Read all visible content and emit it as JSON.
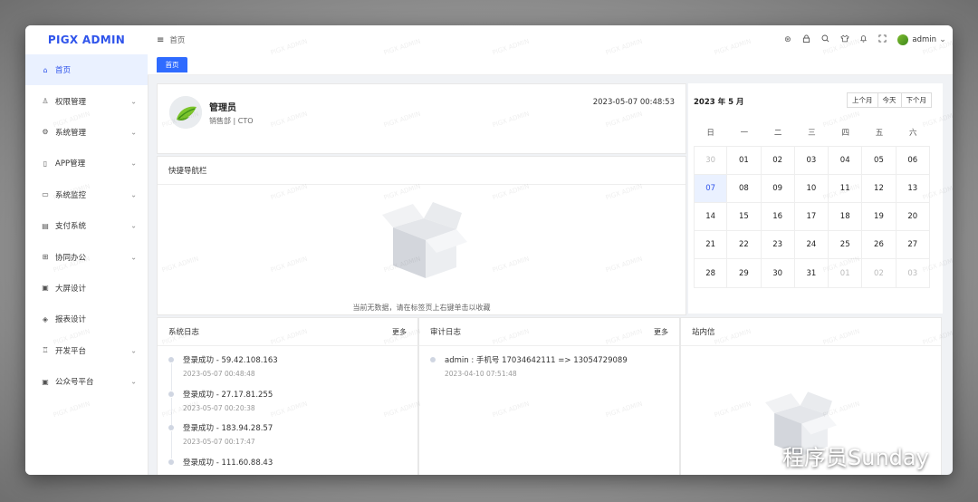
{
  "app": {
    "logo": "PIGX ADMIN",
    "watermark": "PIGX ADMIN"
  },
  "sidebar": {
    "items": [
      {
        "label": "首页",
        "icon": "home-icon",
        "glyph": "⌂",
        "active": true,
        "chevron": false
      },
      {
        "label": "权限管理",
        "icon": "user-icon",
        "glyph": "♙",
        "chevron": true
      },
      {
        "label": "系统管理",
        "icon": "gear-icon",
        "glyph": "⚙",
        "chevron": true
      },
      {
        "label": "APP管理",
        "icon": "phone-icon",
        "glyph": "▯",
        "chevron": true
      },
      {
        "label": "系统监控",
        "icon": "monitor-icon",
        "glyph": "▭",
        "chevron": true
      },
      {
        "label": "支付系统",
        "icon": "payment-icon",
        "glyph": "▤",
        "chevron": true
      },
      {
        "label": "协同办公",
        "icon": "office-icon",
        "glyph": "⊞",
        "chevron": true
      },
      {
        "label": "大屏设计",
        "icon": "screen-icon",
        "glyph": "▣",
        "chevron": false
      },
      {
        "label": "报表设计",
        "icon": "report-icon",
        "glyph": "◈",
        "chevron": false
      },
      {
        "label": "开发平台",
        "icon": "dev-platform-icon",
        "glyph": "♖",
        "chevron": true
      },
      {
        "label": "公众号平台",
        "icon": "wechat-platform-icon",
        "glyph": "▣",
        "chevron": true
      }
    ]
  },
  "topbar": {
    "breadcrumb": "首页",
    "icons": [
      "github-icon",
      "lock-icon",
      "search-icon",
      "shirt-icon",
      "bell-icon",
      "fullscreen-icon"
    ],
    "user": "admin"
  },
  "tabs": [
    {
      "label": "首页",
      "active": true
    }
  ],
  "profile": {
    "name": "管理员",
    "dept": "销售部 | CTO",
    "time": "2023-05-07 00:48:53"
  },
  "quick_nav": {
    "title": "快捷导航栏",
    "empty": "当前无数据，请在标签页上右键单击以收藏"
  },
  "calendar": {
    "title": "2023 年 5 月",
    "buttons": [
      "上个月",
      "今天",
      "下个月"
    ],
    "weekdays": [
      "日",
      "一",
      "二",
      "三",
      "四",
      "五",
      "六"
    ],
    "weeks": [
      [
        {
          "d": "30",
          "m": true
        },
        {
          "d": "01"
        },
        {
          "d": "02"
        },
        {
          "d": "03"
        },
        {
          "d": "04"
        },
        {
          "d": "05"
        },
        {
          "d": "06"
        }
      ],
      [
        {
          "d": "07",
          "t": true
        },
        {
          "d": "08"
        },
        {
          "d": "09"
        },
        {
          "d": "10"
        },
        {
          "d": "11"
        },
        {
          "d": "12"
        },
        {
          "d": "13"
        }
      ],
      [
        {
          "d": "14"
        },
        {
          "d": "15"
        },
        {
          "d": "16"
        },
        {
          "d": "17"
        },
        {
          "d": "18"
        },
        {
          "d": "19"
        },
        {
          "d": "20"
        }
      ],
      [
        {
          "d": "21"
        },
        {
          "d": "22"
        },
        {
          "d": "23"
        },
        {
          "d": "24"
        },
        {
          "d": "25"
        },
        {
          "d": "26"
        },
        {
          "d": "27"
        }
      ],
      [
        {
          "d": "28"
        },
        {
          "d": "29"
        },
        {
          "d": "30"
        },
        {
          "d": "31"
        },
        {
          "d": "01",
          "m": true
        },
        {
          "d": "02",
          "m": true
        },
        {
          "d": "03",
          "m": true
        }
      ]
    ]
  },
  "system_log": {
    "title": "系统日志",
    "more": "更多",
    "items": [
      {
        "title": "登录成功 - 59.42.108.163",
        "time": "2023-05-07 00:48:48"
      },
      {
        "title": "登录成功 - 27.17.81.255",
        "time": "2023-05-07 00:20:38"
      },
      {
        "title": "登录成功 - 183.94.28.57",
        "time": "2023-05-07 00:17:47"
      },
      {
        "title": "登录成功 - 111.60.88.43",
        "time": ""
      }
    ]
  },
  "audit_log": {
    "title": "审计日志",
    "more": "更多",
    "items": [
      {
        "title": "admin : 手机号 17034642111 => 13054729089",
        "time": "2023-04-10 07:51:48"
      }
    ]
  },
  "messages": {
    "title": "站内信"
  },
  "overlay": {
    "wechat_text": "程序员Sunday"
  }
}
